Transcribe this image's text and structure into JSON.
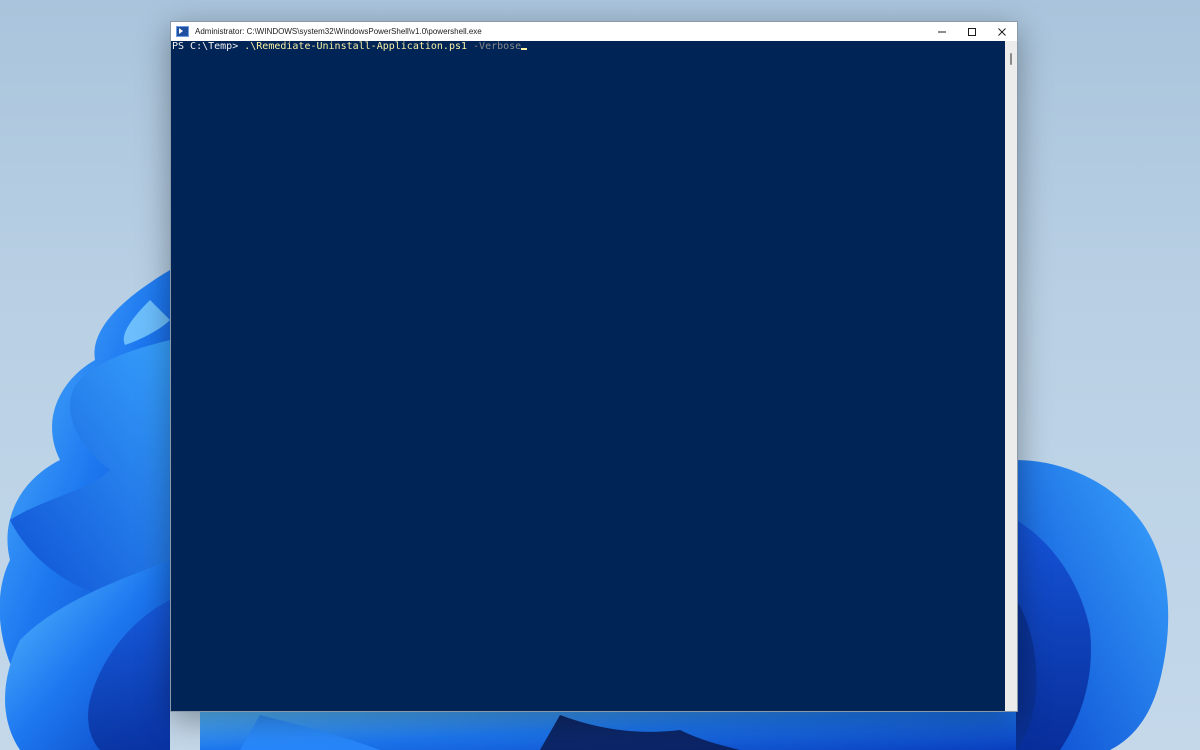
{
  "window": {
    "title": "Administrator: C:\\WINDOWS\\system32\\WindowsPowerShell\\v1.0\\powershell.exe",
    "icon": "powershell-icon",
    "controls": [
      "minimize-icon",
      "maximize-icon",
      "close-icon"
    ]
  },
  "console": {
    "background": "#012456",
    "prompt": "PS C:\\Temp> ",
    "command": ".\\Remediate-Uninstall-Application.ps1",
    "parameter": " -Verbose"
  },
  "colors": {
    "command": "#f9f1a5",
    "parameter": "#8a8a8a",
    "prompt": "#f2f2f2"
  }
}
